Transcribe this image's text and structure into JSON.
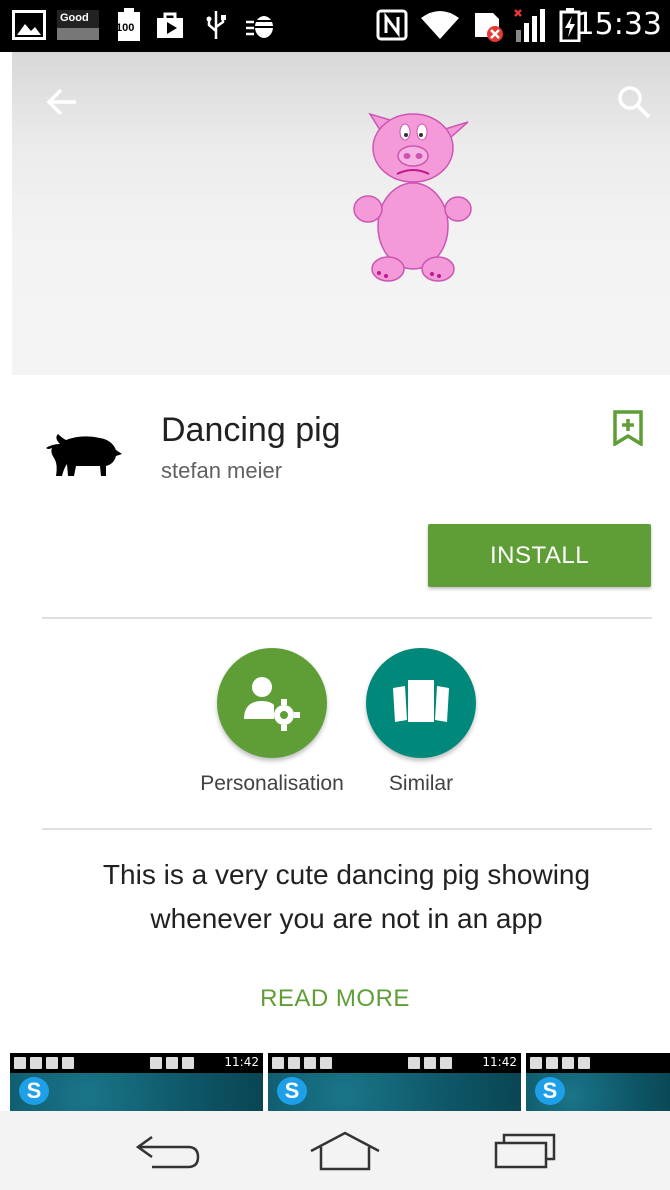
{
  "status_bar": {
    "time": "15:33",
    "icons": [
      "gallery-icon",
      "good-icon",
      "battery-100-icon",
      "play-store-icon",
      "usb-icon",
      "bug-icon",
      "nfc-icon",
      "wifi-icon",
      "sim-error-icon",
      "signal-icon",
      "battery-charging-icon"
    ],
    "good_label": "Good",
    "battery_label": "100"
  },
  "header": {
    "back_icon": "arrow-back-icon",
    "search_icon": "search-icon"
  },
  "app": {
    "title": "Dancing pig",
    "developer": "stefan meier",
    "install_label": "INSTALL",
    "accent_color": "#5f9e37"
  },
  "badges": [
    {
      "label": "Personalisation",
      "icon": "person-settings-icon",
      "color": "#5f9e37"
    },
    {
      "label": "Similar",
      "icon": "similar-cards-icon",
      "color": "#00897b"
    }
  ],
  "description": "This is a very cute dancing pig showing whenever you are not in an app",
  "read_more_label": "READ MORE",
  "screenshots": [
    {
      "time": "11:42"
    },
    {
      "time": "11:42"
    },
    {
      "time": ""
    }
  ],
  "nav": {
    "back": "back-nav-icon",
    "home": "home-nav-icon",
    "recents": "recents-nav-icon"
  }
}
